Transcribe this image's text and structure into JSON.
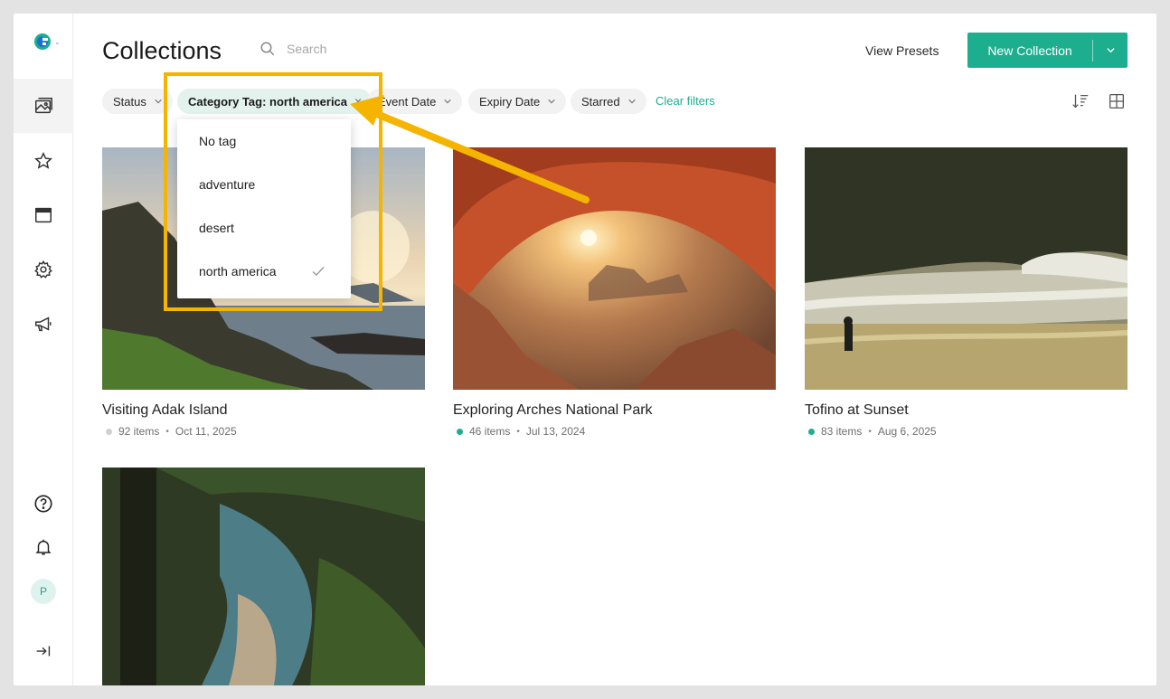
{
  "header": {
    "title": "Collections",
    "search_placeholder": "Search",
    "view_presets": "View Presets",
    "new_collection": "New Collection"
  },
  "filters": {
    "status": "Status",
    "category_tag": "Category Tag: north america",
    "event_date": "Event Date",
    "expiry_date": "Expiry Date",
    "starred": "Starred",
    "clear": "Clear filters"
  },
  "dropdown": {
    "items": [
      {
        "label": "No tag",
        "checked": false
      },
      {
        "label": "adventure",
        "checked": false
      },
      {
        "label": "desert",
        "checked": false
      },
      {
        "label": "north america",
        "checked": true
      }
    ]
  },
  "collections": [
    {
      "title": "Visiting Adak Island",
      "items": "92 items",
      "date": "Oct 11, 2025",
      "status_color": "#cfcfcf"
    },
    {
      "title": "Exploring Arches National Park",
      "items": "46 items",
      "date": "Jul 13, 2024",
      "status_color": "#1dae8f"
    },
    {
      "title": "Tofino at Sunset",
      "items": "83 items",
      "date": "Aug 6, 2025",
      "status_color": "#1dae8f"
    },
    {
      "title": "",
      "items": "",
      "date": "",
      "status_color": ""
    }
  ],
  "sidebar": {
    "avatar_initial": "P",
    "icons": [
      "logo-icon",
      "media-icon",
      "star-icon",
      "window-icon",
      "gear-icon",
      "megaphone-icon",
      "help-icon",
      "bell-icon",
      "avatar",
      "collapse-icon"
    ]
  },
  "colors": {
    "accent": "#1dae8f",
    "highlight": "#f4b400",
    "active_pill": "#e3f2ed"
  }
}
